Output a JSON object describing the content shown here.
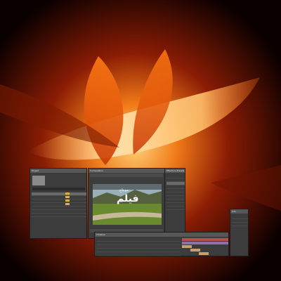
{
  "colors": {
    "panel": "#3c3c3c",
    "titlebar": "#575757",
    "accent": "#e58a1a",
    "track_red": "#b84f4f",
    "track_purple": "#8d73a8"
  },
  "preview": {
    "title_arabic": "فيلم",
    "subtitle_arabic": "مونتاج"
  },
  "project_panel": {
    "title": "Project"
  },
  "composition_panel": {
    "title": "Composition"
  },
  "timeline_panel": {
    "title": "Timeline"
  },
  "effects_panel": {
    "title": "Effects & Presets"
  },
  "side_panel": {
    "title": "Info"
  }
}
